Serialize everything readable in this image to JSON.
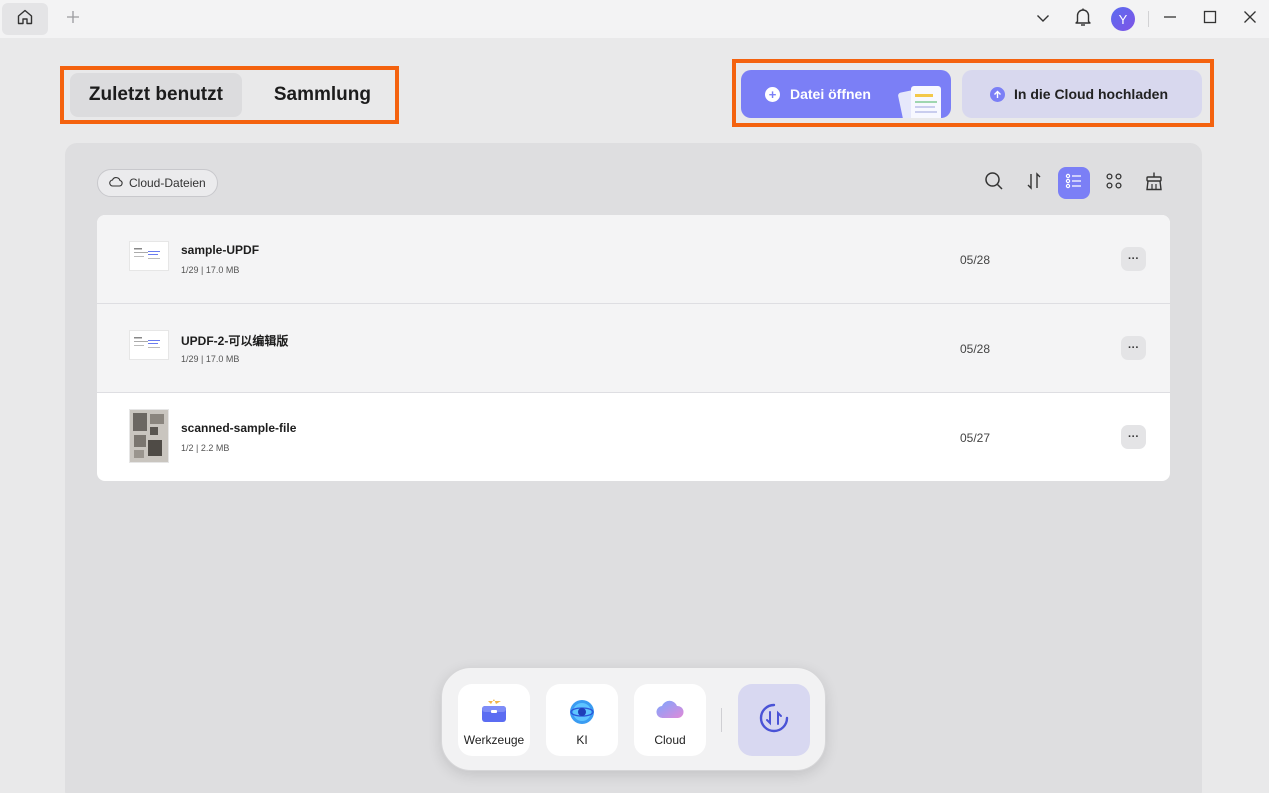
{
  "titlebar": {
    "home_icon": "home-icon",
    "add_tab_icon": "plus-icon",
    "avatar_letter": "Y"
  },
  "tabs": [
    {
      "label": "Zuletzt benutzt",
      "active": true
    },
    {
      "label": "Sammlung",
      "active": false
    }
  ],
  "actions": {
    "open_label": "Datei öffnen",
    "cloud_upload_label": "In die Cloud hochladen"
  },
  "panel": {
    "cloud_files_label": "Cloud-Dateien",
    "view_mode": "list"
  },
  "files": [
    {
      "name": "sample-UPDF",
      "meta": "1/29 | 17.0 MB",
      "date": "05/28"
    },
    {
      "name": "UPDF-2-可以编辑版",
      "meta": "1/29 | 17.0 MB",
      "date": "05/28"
    },
    {
      "name": "scanned-sample-file",
      "meta": "1/2 | 2.2 MB",
      "date": "05/27"
    }
  ],
  "dock": {
    "tools_label": "Werkzeuge",
    "ai_label": "KI",
    "cloud_label": "Cloud"
  },
  "colors": {
    "accent": "#7b7ff6",
    "highlight": "#f4620f"
  }
}
